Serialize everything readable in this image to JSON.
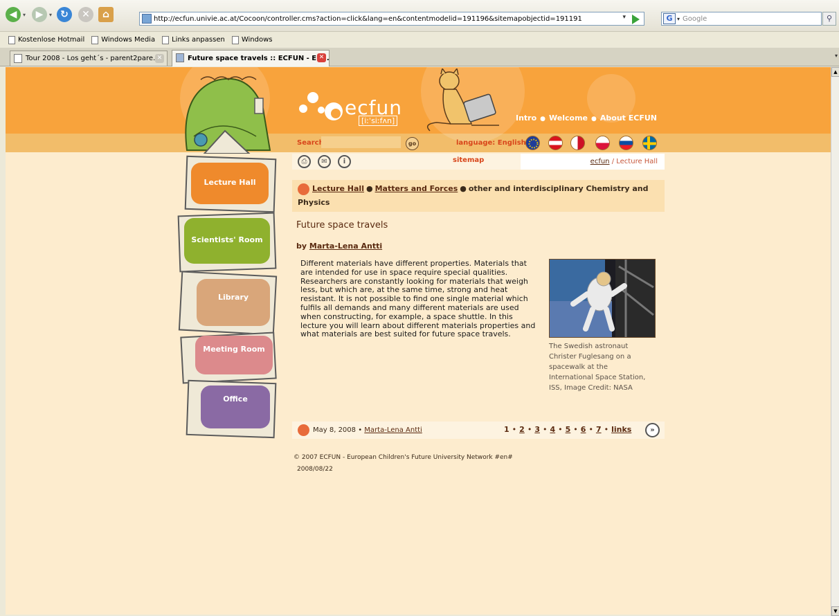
{
  "browser": {
    "url": "http://ecfun.univie.ac.at/Cocoon/controller.cms?action=click&lang=en&contentmodelid=191196&sitemapobjectid=191191",
    "search_placeholder": "Google",
    "bookmarks": [
      "Kostenlose Hotmail",
      "Windows Media",
      "Links anpassen",
      "Windows"
    ],
    "tabs": [
      {
        "label": "Tour 2008 - Los geht´s - parent2pare..."
      },
      {
        "label": "Future space travels :: ECFUN - Eu..."
      }
    ]
  },
  "site": {
    "logo": "ecfun",
    "logo_phonetic": "[iːˈsiːfʌn]",
    "nav": [
      "Intro",
      "Welcome",
      "About ECFUN"
    ],
    "nav_sep": "●",
    "search_label": "Search",
    "go_label": "go",
    "language_label": "language: English",
    "sitemap": "sitemap",
    "crumb_home": "ecfun",
    "crumb_current": " / Lecture Hall",
    "rooms": [
      "Lecture Hall",
      "Scientists' Room",
      "Library",
      "Meeting Room",
      "Office"
    ],
    "flags": [
      {
        "name": "eu-flag-icon",
        "color": "#1f3d99"
      },
      {
        "name": "austria-flag-icon",
        "color": "#d9141e"
      },
      {
        "name": "malta-flag-icon",
        "color": "#ce1126"
      },
      {
        "name": "poland-flag-icon",
        "color": "#dc143c"
      },
      {
        "name": "slovakia-flag-icon",
        "color": "#0b4ea2"
      },
      {
        "name": "sweden-flag-icon",
        "color": "#006aa7"
      }
    ]
  },
  "breadcrumb": {
    "lecture_hall": "Lecture Hall",
    "sep": "●",
    "matters": "Matters and Forces",
    "topic": "other and interdisciplinary Chemistry and Physics"
  },
  "article": {
    "title": "Future space travels",
    "by": "by ",
    "author": "Marta-Lena Antti",
    "body": "Different materials have different properties. Materials that are intended for use in space require special qualities. Researchers are constantly looking for materials that weigh less, but which are, at the same time, strong and heat resistant. It is not possible to find one single material which fulfils all demands and many different materials are used when constructing, for example, a space shuttle. In this lecture you will learn about different materials properties and what materials are best suited for future space travels.",
    "caption": "The Swedish astronaut Christer Fuglesang on a spacewalk at the International Space Station, ISS, Image Credit: NASA"
  },
  "footer": {
    "date": "May 8, 2008",
    "bullet": " • ",
    "author": "Marta-Lena Antti",
    "pages": [
      "1",
      "2",
      "3",
      "4",
      "5",
      "6",
      "7",
      "links"
    ],
    "page_sep": "•",
    "next": "»",
    "copyright": "© 2007  ECFUN - European Children's Future University Network #en#",
    "stamp": "2008/08/22"
  }
}
